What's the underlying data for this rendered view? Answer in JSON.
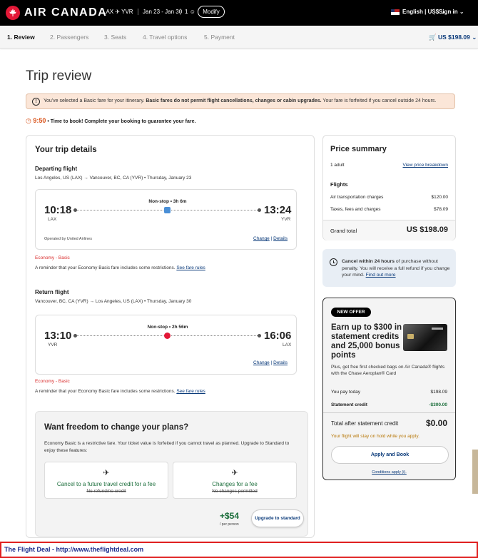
{
  "header": {
    "brand": "AIR CANADA",
    "route": "LAX ✈ YVR",
    "dates": "Jan 23 - Jan 30",
    "passengers": "1",
    "modify_label": "Modify",
    "language": "English | US$",
    "sign_in": "Sign in"
  },
  "steps": [
    {
      "label": "1. Review",
      "active": true
    },
    {
      "label": "2. Passengers"
    },
    {
      "label": "3. Seats"
    },
    {
      "label": "4. Travel options"
    },
    {
      "label": "5. Payment"
    }
  ],
  "cart_total": "US $198.09",
  "page_title": "Trip review",
  "notice": {
    "prefix": "You've selected a Basic fare for your itinerary. ",
    "bold": "Basic fares do not permit flight cancellations, changes or cabin upgrades.",
    "suffix": " Your fare is forfeited if you cancel outside 24 hours."
  },
  "timer": {
    "time": "9:50",
    "text": " • Time to book! Complete your booking to guarantee your fare."
  },
  "trip": {
    "title": "Your trip details",
    "departing": {
      "heading": "Departing flight",
      "subtitle": "Los Angeles, US (LAX) → Vancouver, BC, CA (YVR) • Thursday, January 23",
      "dep_time": "10:18",
      "dep_airport": "LAX",
      "arr_time": "13:24",
      "arr_airport": "YVR",
      "stops": "Non-stop • 3h 6m",
      "operated_by": "Operated by United Airlines",
      "change": "Change",
      "details": "Details",
      "fare_name": "Economy - Basic",
      "fare_note": "A reminder that your Economy Basic fare includes some restrictions.",
      "fare_rules": "See fare rules"
    },
    "return": {
      "heading": "Return flight",
      "subtitle": "Vancouver, BC, CA (YVR) → Los Angeles, US (LAX) • Thursday, January 30",
      "dep_time": "13:10",
      "dep_airport": "YVR",
      "arr_time": "16:06",
      "arr_airport": "LAX",
      "stops": "Non-stop • 2h 56m",
      "change": "Change",
      "details": "Details",
      "fare_name": "Economy - Basic",
      "fare_note": "A reminder that your Economy Basic fare includes some restrictions.",
      "fare_rules": "See fare rules"
    }
  },
  "upsell": {
    "title": "Want freedom to change your plans?",
    "desc": "Economy Basic is a restrictive fare. Your ticket value is forfeited if you cannot travel as planned. Upgrade to Standard to enjoy these features:",
    "feature1_title": "Cancel to a future travel credit for a fee",
    "feature1_old": "No refund/no credit",
    "feature2_title": "Changes for a fee",
    "feature2_old": "No changes permitted",
    "price": "+$54",
    "per": "/ per person",
    "button": "Upgrade to standard"
  },
  "price_summary": {
    "title": "Price summary",
    "adults": "1 adult",
    "breakdown_link": "View price breakdown",
    "flights_heading": "Flights",
    "air_label": "Air transportation charges",
    "air_value": "$120.00",
    "tax_label": "Taxes, fees and charges",
    "tax_value": "$78.09",
    "grand_label": "Grand total",
    "grand_value": "US $198.09"
  },
  "cancel_info": {
    "bold": "Cancel within 24 hours",
    "text": " of purchase without penalty. You will receive a full refund if you change your mind. ",
    "link": "Find out more"
  },
  "offer": {
    "badge": "NEW OFFER",
    "headline": "Earn up to $300 in statement credits and 25,000 bonus points",
    "desc": "Plus, get free first checked bags on Air Canada® flights with the Chase Aeroplan® Card",
    "pay_today_label": "You pay today",
    "pay_today_value": "$198.09",
    "credit_label": "Statement credit",
    "credit_value": "-$300.00",
    "total_label": "Total after statement credit",
    "total_value": "$0.00",
    "hold_note": "Your flight will stay on hold while you apply.",
    "button": "Apply and Book",
    "conditions": "Conditions apply (i)."
  },
  "footer": "The Flight Deal - http://www.theflightdeal.com",
  "colors": {
    "brand_red": "#e31837",
    "link": "#0a3a7a",
    "green": "#1a6d3a",
    "timer": "#d9541c"
  }
}
